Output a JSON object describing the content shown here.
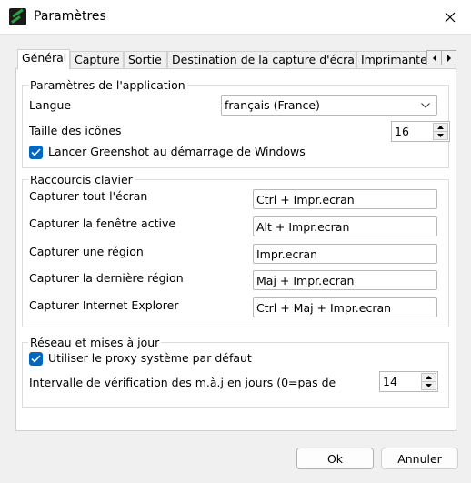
{
  "window": {
    "title": "Paramètres"
  },
  "tabs": [
    "Général",
    "Capture",
    "Sortie",
    "Destination de la capture d'écran",
    "Imprimante"
  ],
  "app_settings": {
    "legend": "Paramètres de l'application",
    "language_label": "Langue",
    "language_value": "français (France)",
    "icon_size_label": "Taille des icônes",
    "icon_size_value": "16",
    "startup_label": "Lancer Greenshot au démarrage de Windows",
    "startup_checked": true
  },
  "hotkeys": {
    "legend": "Raccourcis clavier",
    "items": [
      {
        "label": "Capturer tout l'écran",
        "value": "Ctrl + Impr.ecran"
      },
      {
        "label": "Capturer la fenêtre active",
        "value": "Alt + Impr.ecran"
      },
      {
        "label": "Capturer une région",
        "value": "Impr.ecran"
      },
      {
        "label": "Capturer la dernière région",
        "value": "Maj + Impr.ecran"
      },
      {
        "label": "Capturer Internet Explorer",
        "value": "Ctrl + Maj + Impr.ecran"
      }
    ]
  },
  "network": {
    "legend": "Réseau et mises à jour",
    "proxy_label": "Utiliser le proxy système par défaut",
    "proxy_checked": true,
    "interval_label": "Intervalle de vérification des m.à.j en jours (0=pas de",
    "interval_value": "14"
  },
  "footer": {
    "ok_label": "Ok",
    "cancel_label": "Annuler"
  },
  "colors": {
    "accent": "#0067c0",
    "window_bg": "#f0f0f0",
    "panel_bg": "#ffffff"
  }
}
